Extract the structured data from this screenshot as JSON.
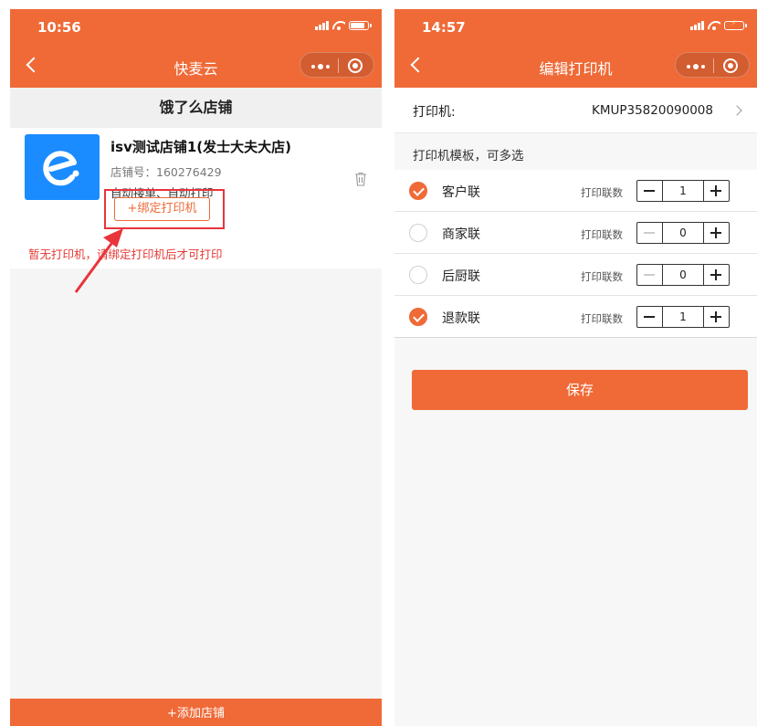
{
  "left": {
    "status_time": "10:56",
    "nav_title": "快麦云",
    "platform_title": "饿了么店铺",
    "store": {
      "name": "isv测试店铺1(发士大夫大店)",
      "store_no": "店铺号：160276429",
      "mode": "自动接单、自动打印",
      "bind_button": "+绑定打印机"
    },
    "warning": "暂无打印机，请绑定打印机后才可打印",
    "add_store_button": "+添加店铺"
  },
  "right": {
    "status_time": "14:57",
    "nav_title": "编辑打印机",
    "printer_label": "打印机:",
    "printer_value": "KMUP35820090008",
    "template_header": "打印机模板，可多选",
    "copies_label": "打印联数",
    "templates": [
      {
        "name": "客户联",
        "checked": true,
        "copies": "1"
      },
      {
        "name": "商家联",
        "checked": false,
        "copies": "0"
      },
      {
        "name": "后厨联",
        "checked": false,
        "copies": "0"
      },
      {
        "name": "退款联",
        "checked": true,
        "copies": "1"
      }
    ],
    "save_button": "保存"
  },
  "colors": {
    "brand": "#ef6a37",
    "warning": "#e53935",
    "annotation": "#e8343a",
    "logo_blue": "#1a8cff"
  }
}
